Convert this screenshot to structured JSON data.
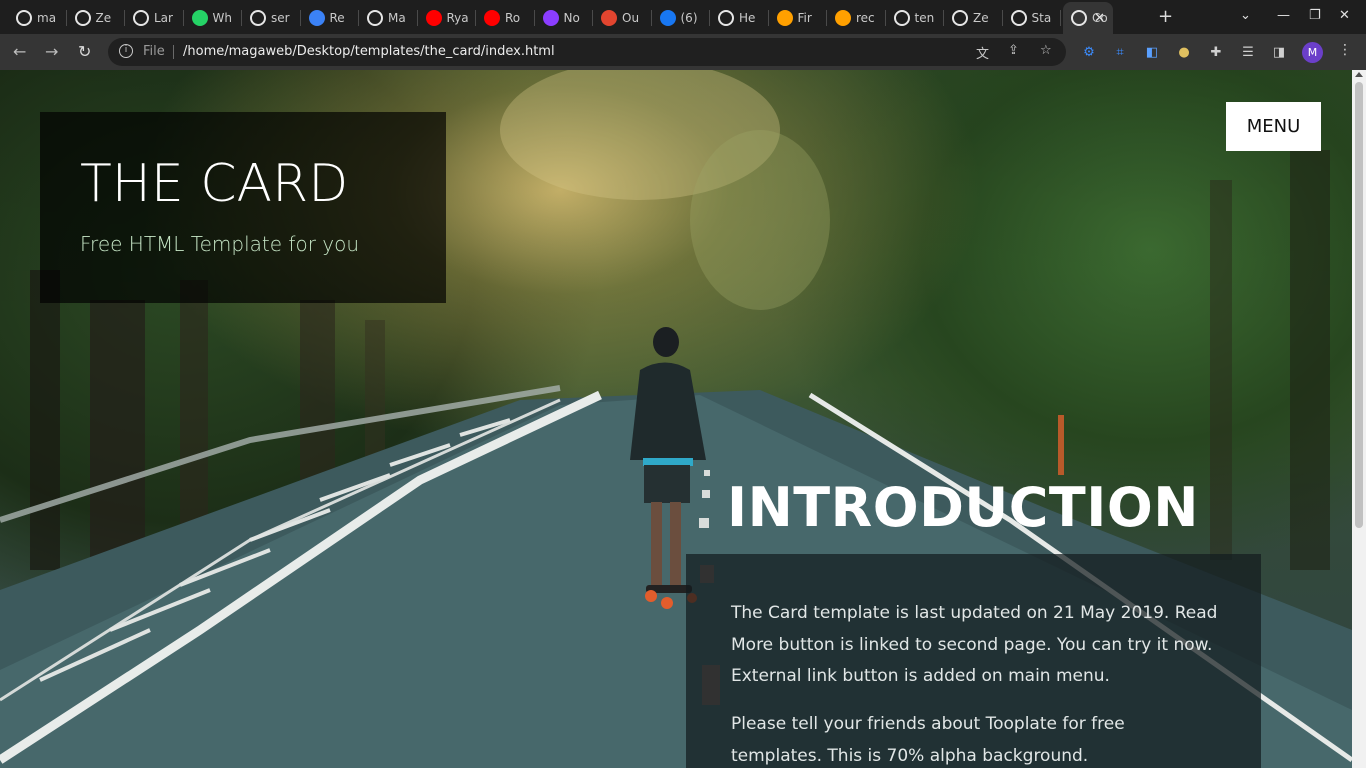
{
  "browser": {
    "tabs": [
      {
        "label": "ma",
        "icon": "github-icon",
        "color": "#ffffff"
      },
      {
        "label": "Ze",
        "icon": "globe-icon",
        "color": "#ffffff"
      },
      {
        "label": "Lar",
        "icon": "globe-icon",
        "color": "#ffffff"
      },
      {
        "label": "Wh",
        "icon": "whatsapp-icon",
        "color": "#25d366"
      },
      {
        "label": "ser",
        "icon": "github-icon",
        "color": "#ffffff"
      },
      {
        "label": "Re",
        "icon": "m-logo-icon",
        "color": "#3b82f6"
      },
      {
        "label": "Ma",
        "icon": "grid-logo-icon",
        "color": "#ffffff"
      },
      {
        "label": "Rya",
        "icon": "youtube-icon",
        "color": "#ff0000"
      },
      {
        "label": "Ro",
        "icon": "youtube-icon",
        "color": "#ff0000"
      },
      {
        "label": "No",
        "icon": "purple-square-icon",
        "color": "#8b3dff"
      },
      {
        "label": "Ou",
        "icon": "cube-icon",
        "color": "#e2452f"
      },
      {
        "label": "(6)",
        "icon": "facebook-icon",
        "color": "#1877f2"
      },
      {
        "label": "He",
        "icon": "globe-icon",
        "color": "#ffffff"
      },
      {
        "label": "Fir",
        "icon": "firebase-icon",
        "color": "#ffa000"
      },
      {
        "label": "rec",
        "icon": "firebase-icon",
        "color": "#ffa000"
      },
      {
        "label": "ten",
        "icon": "github-icon",
        "color": "#ffffff"
      },
      {
        "label": "Ze",
        "icon": "globe-icon",
        "color": "#ffffff"
      },
      {
        "label": "Sta",
        "icon": "globe-icon",
        "color": "#ffffff"
      },
      {
        "label": "Co",
        "icon": "globe-icon",
        "color": "#ffffff"
      }
    ],
    "active_tab_close": "✕",
    "new_tab": "+",
    "scheme_label": "File",
    "url": "/home/magaweb/Desktop/templates/the_card/index.html",
    "profile_initial": "M"
  },
  "page": {
    "site_title": "THE CARD",
    "site_subtitle": "Free HTML Template for you",
    "menu_label": "MENU",
    "intro_heading": "INTRODUCTION",
    "intro_paragraphs": [
      "The Card template is last updated on 21 May 2019. Read More button is linked to second page. You can try it now. External link button is added on main menu.",
      "Please tell your friends about Tooplate for free templates. This is 70% alpha background."
    ]
  }
}
